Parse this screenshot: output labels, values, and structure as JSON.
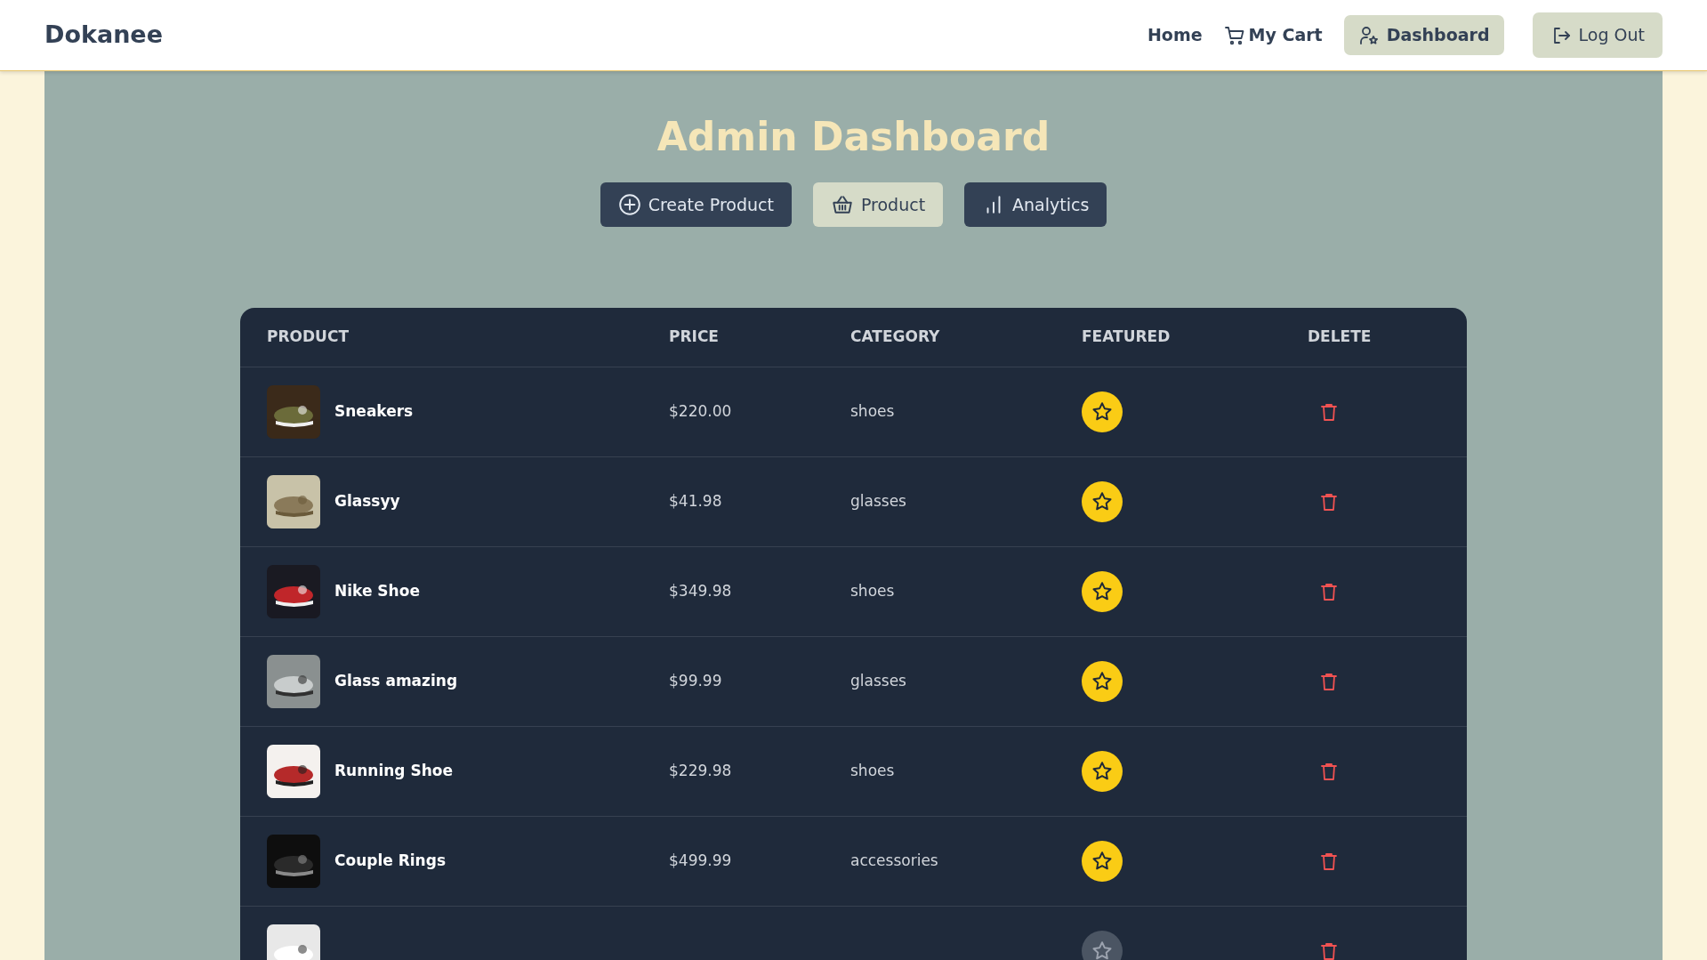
{
  "brand": "Dokanee",
  "nav": [
    {
      "label": "Home",
      "kind": "link"
    },
    {
      "label": "My Cart",
      "kind": "cart"
    },
    {
      "label": "Dashboard",
      "kind": "dashboard"
    },
    {
      "label": "Log Out",
      "kind": "logout"
    }
  ],
  "title": "Admin Dashboard",
  "tabs": [
    {
      "label": "Create Product",
      "kind": "create",
      "selected": false
    },
    {
      "label": "Product",
      "kind": "product",
      "selected": true
    },
    {
      "label": "Analytics",
      "kind": "analytics",
      "selected": false
    }
  ],
  "table": {
    "columns": [
      "PRODUCT",
      "PRICE",
      "CATEGORY",
      "FEATURED",
      "DELETE"
    ],
    "rows": [
      {
        "name": "Sneakers",
        "price": "$220.00",
        "category": "shoes",
        "featured": true
      },
      {
        "name": "Glassyy",
        "price": "$41.98",
        "category": "glasses",
        "featured": true
      },
      {
        "name": "Nike Shoe",
        "price": "$349.98",
        "category": "shoes",
        "featured": true
      },
      {
        "name": "Glass amazing",
        "price": "$99.99",
        "category": "glasses",
        "featured": true
      },
      {
        "name": "Running Shoe",
        "price": "$229.98",
        "category": "shoes",
        "featured": true
      },
      {
        "name": "Couple Rings",
        "price": "$499.99",
        "category": "accessories",
        "featured": true
      },
      {
        "featured": false
      }
    ]
  }
}
